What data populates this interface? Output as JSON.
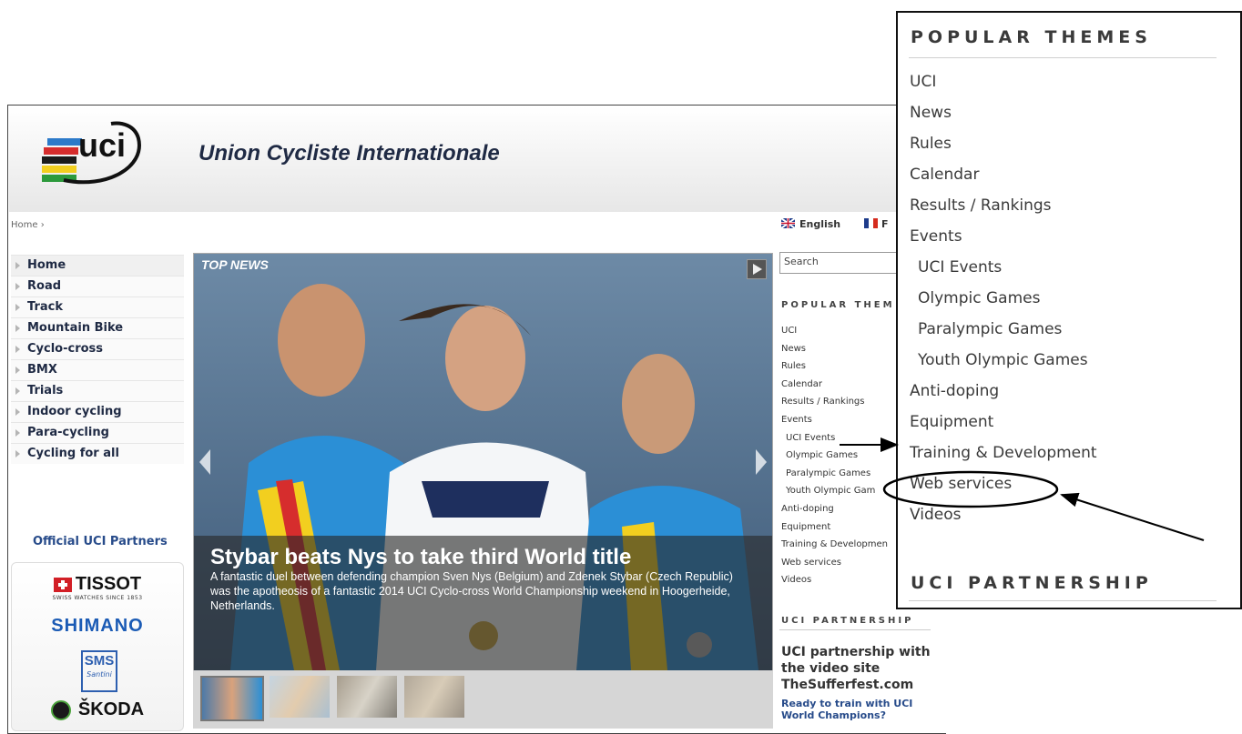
{
  "header": {
    "site_title": "Union Cycliste Internationale",
    "logo_text": "uci"
  },
  "breadcrumb": "Home ›",
  "languages": {
    "english": "English",
    "french": "F"
  },
  "leftnav": {
    "items": [
      "Home",
      "Road",
      "Track",
      "Mountain Bike",
      "Cyclo-cross",
      "BMX",
      "Trials",
      "Indoor cycling",
      "Para-cycling",
      "Cycling for all"
    ],
    "active_index": 0
  },
  "partners": {
    "title": "Official UCI Partners",
    "tissot": "TISSOT",
    "tissot_tag": "SWISS WATCHES SINCE 1853",
    "shimano": "SHIMANO",
    "sms": "SMS",
    "sms_sub": "Santini",
    "skoda": "ŠKODA"
  },
  "carousel": {
    "label": "TOP NEWS",
    "headline": "Stybar beats Nys to take third World title",
    "summary": "A fantastic duel between defending champion Sven Nys (Belgium) and Zdenek Stybar (Czech Republic) was the apotheosis of a fantastic 2014 UCI Cyclo-cross World Championship weekend in Hoogerheide, Netherlands.",
    "thumb_count": 4
  },
  "right": {
    "search_placeholder": "Search",
    "popular_title": "POPULAR THEMES",
    "popular_title_cut": "POPULAR THEM",
    "themes": [
      "UCI",
      "News",
      "Rules",
      "Calendar",
      "Results / Rankings",
      "Events",
      "UCI Events",
      "Olympic Games",
      "Paralympic Games",
      "Youth Olympic Games",
      "Anti-doping",
      "Equipment",
      "Training & Development",
      "Web services",
      "Videos"
    ],
    "themes_cut": [
      "UCI",
      "News",
      "Rules",
      "Calendar",
      "Results / Rankings",
      "Events",
      "UCI Events",
      "Olympic Games",
      "Paralympic Games",
      "Youth Olympic Gam",
      "Anti-doping",
      "Equipment",
      "Training & Developmen",
      "Web services",
      "Videos"
    ],
    "partnership_title": "UCI PARTNERSHIP",
    "partnership_headline": "UCI partnership with the video site TheSufferfest.com",
    "partnership_link": "Ready to train with UCI World Champions?"
  },
  "zoom": {
    "title": "POPULAR THEMES",
    "items": [
      "UCI",
      "News",
      "Rules",
      "Calendar",
      "Results / Rankings",
      "Events",
      "UCI Events",
      "Olympic Games",
      "Paralympic Games",
      "Youth Olympic Games",
      "Anti-doping",
      "Equipment",
      "Training & Development",
      "Web services",
      "Videos"
    ],
    "subitems": [
      6,
      7,
      8,
      9
    ],
    "highlighted": "Web services",
    "title2": "UCI PARTNERSHIP"
  },
  "colors": {
    "nav_text": "#1f2a44",
    "partners_title": "#274b8a",
    "link": "#274b8a"
  }
}
